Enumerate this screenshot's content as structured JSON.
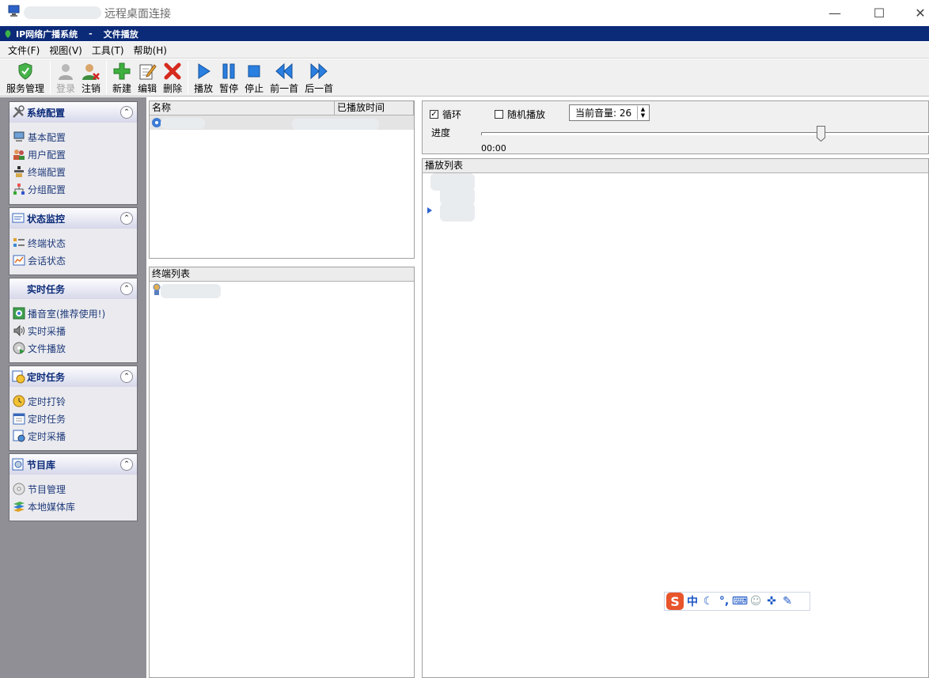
{
  "rdp_window": {
    "title": "远程桌面连接",
    "minimize_glyph": "—",
    "maximize_glyph": "☐",
    "close_glyph": "✕"
  },
  "app": {
    "name": "IP网络广播系统",
    "separator": "-",
    "section": "文件播放",
    "title_bg": "#0b2a78"
  },
  "menu": [
    "文件(F)",
    "视图(V)",
    "工具(T)",
    "帮助(H)"
  ],
  "toolbar": {
    "service": "服务管理",
    "login": "登录",
    "logout": "注销",
    "new": "新建",
    "edit": "编辑",
    "delete": "删除",
    "play": "播放",
    "pause": "暂停",
    "stop": "停止",
    "prev": "前一首",
    "next": "后一首"
  },
  "nav": {
    "config": {
      "title": "系统配置",
      "items": [
        "基本配置",
        "用户配置",
        "终端配置",
        "分组配置"
      ]
    },
    "monitor": {
      "title": "状态监控",
      "items": [
        "终端状态",
        "会话状态"
      ]
    },
    "realtime": {
      "title": "实时任务",
      "items": [
        "播音室(推荐使用!)",
        "实时采播",
        "文件播放"
      ]
    },
    "scheduled": {
      "title": "定时任务",
      "items": [
        "定时打铃",
        "定时任务",
        "定时采播"
      ]
    },
    "library": {
      "title": "节目库",
      "items": [
        "节目管理",
        "本地媒体库"
      ]
    }
  },
  "file_list": {
    "col_name": "名称",
    "col_played": "已播放时间"
  },
  "terminal_list": {
    "header": "终端列表"
  },
  "player": {
    "loop_label": "循环",
    "loop_checked": true,
    "random_label": "随机播放",
    "random_checked": false,
    "volume_label": "当前音量: 26",
    "progress_label": "进度",
    "elapsed": "00:00",
    "progress_fraction": 0.88
  },
  "playlist": {
    "header": "播放列表"
  },
  "ime": {
    "logo": "S",
    "mode": "中"
  }
}
